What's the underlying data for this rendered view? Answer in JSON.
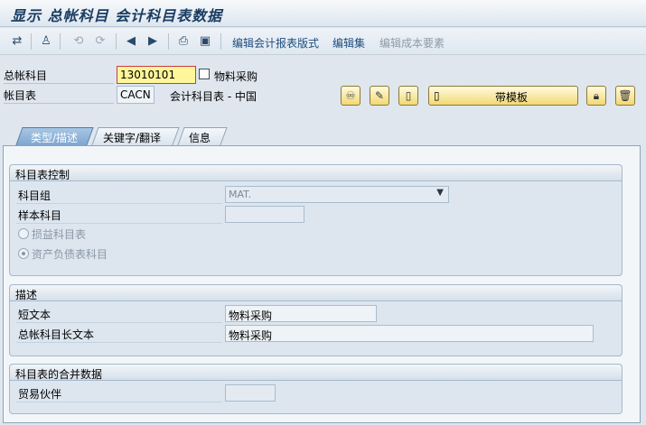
{
  "window_title": "显示 总帐科目 会计科目表数据",
  "toolbar": {
    "icons": [
      "switch-icon",
      "hierarchy-icon",
      "back-link-icon",
      "forward-link-icon",
      "previous-icon",
      "next-icon",
      "print-icon",
      "document-icon"
    ],
    "links": [
      {
        "label": "编辑会计报表版式",
        "enabled": true
      },
      {
        "label": "编辑集",
        "enabled": true
      },
      {
        "label": "编辑成本要素",
        "enabled": false
      }
    ]
  },
  "header": {
    "gl_account_label": "总帐科目",
    "gl_account_value": "13010101",
    "gl_account_desc": "物料采购",
    "chart_label": "帐目表",
    "chart_value": "CACN",
    "chart_desc": "会计科目表 - 中国",
    "template_button": "带模板"
  },
  "tabs": [
    {
      "label": "类型/描述",
      "active": true
    },
    {
      "label": "关键字/翻译",
      "active": false
    },
    {
      "label": "信息",
      "active": false
    }
  ],
  "control_group": {
    "title": "科目表控制",
    "account_group_label": "科目组",
    "account_group_value": "MAT.",
    "sample_account_label": "样本科目",
    "sample_account_value": "",
    "radio_pl": "损益科目表",
    "radio_bs": "资产负债表科目",
    "selected_radio": "资产负债表科目"
  },
  "description_group": {
    "title": "描述",
    "short_text_label": "短文本",
    "short_text_value": "物料采购",
    "long_text_label": "总帐科目长文本",
    "long_text_value": "物料采购"
  },
  "consolidation_group": {
    "title": "科目表的合并数据",
    "trading_partner_label": "贸易伙伴",
    "trading_partner_value": ""
  },
  "colors": {
    "accent": "#1a3c62",
    "field_highlight": "#fff69a",
    "button_yellow": "#f2d974"
  }
}
